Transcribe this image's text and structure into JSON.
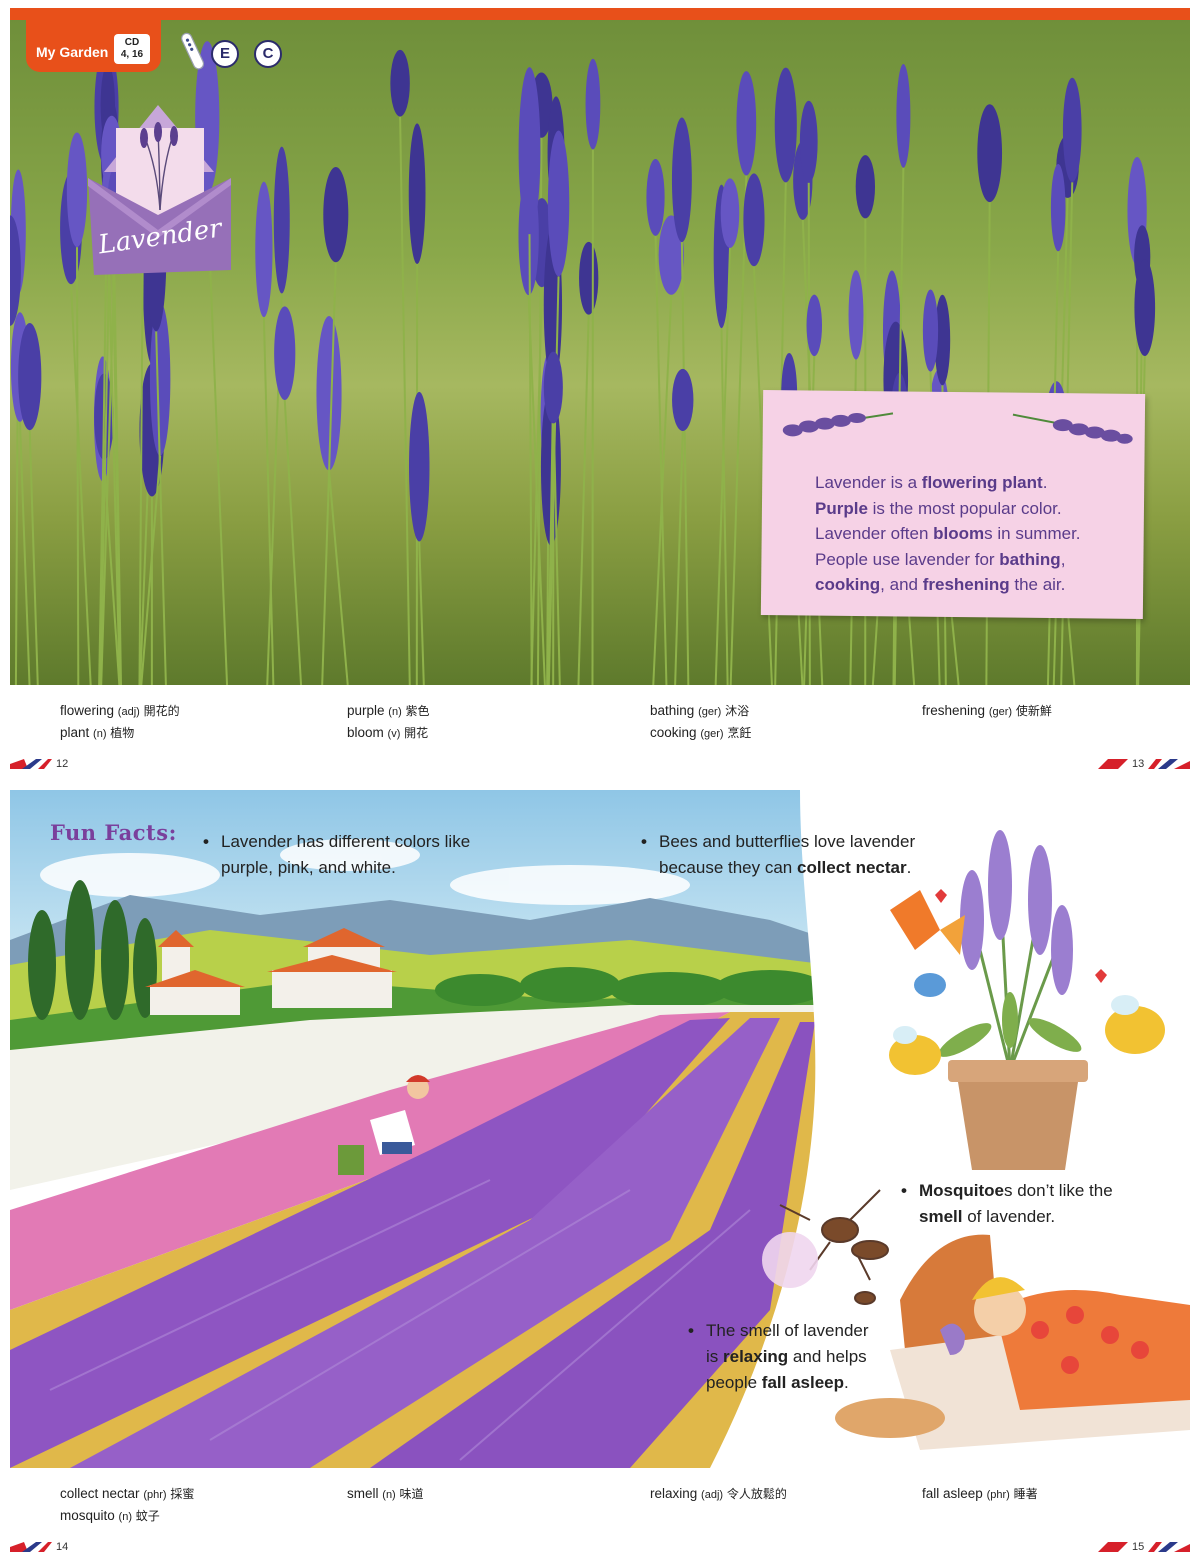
{
  "header": {
    "section_label": "My Garden",
    "cd_label": "CD",
    "cd_tracks": "4, 16",
    "buttons": [
      "E",
      "C"
    ]
  },
  "title_card": {
    "title": "Lavender"
  },
  "info": {
    "lines": [
      [
        {
          "t": "Lavender is a ",
          "b": false
        },
        {
          "t": "flowering plant",
          "b": true
        },
        {
          "t": ".",
          "b": false
        }
      ],
      [
        {
          "t": "Purple",
          "b": true
        },
        {
          "t": " is the most popular color.",
          "b": false
        }
      ],
      [
        {
          "t": "Lavender often ",
          "b": false
        },
        {
          "t": "bloom",
          "b": true
        },
        {
          "t": "s in summer.",
          "b": false
        }
      ],
      [
        {
          "t": "People use lavender for ",
          "b": false
        },
        {
          "t": "bathing",
          "b": true
        },
        {
          "t": ",",
          "b": false
        }
      ],
      [
        {
          "t": "cooking",
          "b": true
        },
        {
          "t": ", and ",
          "b": false
        },
        {
          "t": "freshening",
          "b": true
        },
        {
          "t": " the air.",
          "b": false
        }
      ]
    ]
  },
  "vocab_top": [
    {
      "word": "flowering",
      "pos": "(adj)",
      "zh": "開花的"
    },
    {
      "word": "plant",
      "pos": "(n)",
      "zh": "植物"
    },
    {
      "word": "purple",
      "pos": "(n)",
      "zh": "紫色"
    },
    {
      "word": "bloom",
      "pos": "(v)",
      "zh": "開花"
    },
    {
      "word": "bathing",
      "pos": "(ger)",
      "zh": "沐浴"
    },
    {
      "word": "cooking",
      "pos": "(ger)",
      "zh": "烹飪"
    },
    {
      "word": "freshening",
      "pos": "(ger)",
      "zh": "使新鮮"
    }
  ],
  "page_numbers": [
    "12",
    "13",
    "14",
    "15"
  ],
  "fun_facts": {
    "title": "Fun Facts:",
    "facts": [
      [
        [
          {
            "t": "Lavender has different colors like",
            "b": false
          }
        ],
        [
          {
            "t": "purple, pink, and white.",
            "b": false
          }
        ]
      ],
      [
        [
          {
            "t": "Bees and butterflies love lavender",
            "b": false
          }
        ],
        [
          {
            "t": "because they can ",
            "b": false
          },
          {
            "t": "collect nectar",
            "b": true
          },
          {
            "t": ".",
            "b": false
          }
        ]
      ],
      [
        [
          {
            "t": "Mosquitoe",
            "b": true
          },
          {
            "t": "s don’t like the",
            "b": false
          }
        ],
        [
          {
            "t": "smell",
            "b": true
          },
          {
            "t": " of lavender.",
            "b": false
          }
        ]
      ],
      [
        [
          {
            "t": "The smell of lavender",
            "b": false
          }
        ],
        [
          {
            "t": "is ",
            "b": false
          },
          {
            "t": "relaxing",
            "b": true
          },
          {
            "t": " and helps",
            "b": false
          }
        ],
        [
          {
            "t": "people ",
            "b": false
          },
          {
            "t": "fall asleep",
            "b": true
          },
          {
            "t": ".",
            "b": false
          }
        ]
      ]
    ]
  },
  "vocab_bottom": [
    {
      "word": "collect nectar",
      "pos": "(phr)",
      "zh": "採蜜"
    },
    {
      "word": "mosquito",
      "pos": "(n)",
      "zh": "蚊子"
    },
    {
      "word": "smell",
      "pos": "(n)",
      "zh": "味道"
    },
    {
      "word": "relaxing",
      "pos": "(adj)",
      "zh": "令人放鬆的"
    },
    {
      "word": "fall asleep",
      "pos": "(phr)",
      "zh": "睡著"
    }
  ],
  "colors": {
    "brand_orange": "#e8501a",
    "lavender_purple": "#5a3b8a",
    "card_pink": "#f6d2e6",
    "fun_title": "#7a3f9c"
  }
}
